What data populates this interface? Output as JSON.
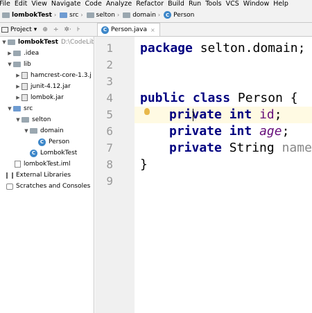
{
  "menu": [
    "File",
    "Edit",
    "View",
    "Navigate",
    "Code",
    "Analyze",
    "Refactor",
    "Build",
    "Run",
    "Tools",
    "VCS",
    "Window",
    "Help"
  ],
  "breadcrumb": {
    "project": "lombokTest",
    "items": [
      "src",
      "selton",
      "domain",
      "Person"
    ]
  },
  "project_panel": {
    "title": "Project",
    "dropdown": "▾",
    "tools": [
      "⊕",
      "÷",
      "✲·",
      "⊦"
    ]
  },
  "tree": {
    "root": {
      "name": "lombokTest",
      "path": "D:\\CodeLibr"
    },
    "idea": ".idea",
    "lib": "lib",
    "jar1": "hamcrest-core-1.3.j",
    "jar2": "junit-4.12.jar",
    "jar3": "lombok.jar",
    "src": "src",
    "selton": "selton",
    "domain": "domain",
    "person": "Person",
    "lomboktest_class": "LombokTest",
    "iml": "lombokTest.iml",
    "ext_libs": "External Libraries",
    "scratches": "Scratches and Consoles"
  },
  "editor_tab": {
    "label": "Person.java",
    "close": "×"
  },
  "line_numbers": [
    "1",
    "2",
    "3",
    "4",
    "5",
    "6",
    "7",
    "8",
    "9"
  ],
  "code": {
    "l1_kw": "package",
    "l1_rest": " selton.domain;",
    "l4_kw1": "public",
    "l4_kw2": "class",
    "l4_rest": " Person {",
    "l5_kw": "private",
    "l5_type": "int",
    "l5_field": "id",
    "l6_kw": "private",
    "l6_type": "int",
    "l6_field": "age",
    "l7_kw": "private",
    "l7_type": "String",
    "l7_field": "name",
    "l8": "}",
    "semicolon": ";"
  },
  "colors": {
    "keyword": "#000080",
    "field": "#660e7a",
    "highlight_line": "#fffae3",
    "gutter": "#f0f0f0"
  }
}
